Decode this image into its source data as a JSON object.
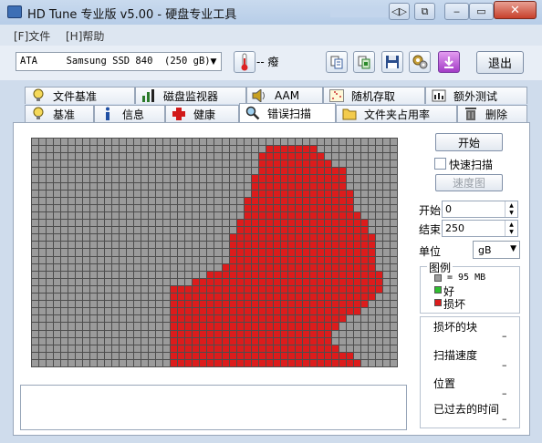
{
  "window": {
    "title": "HD Tune 专业版 v5.00 - 硬盘专业工具",
    "controls": {
      "compact": "◁▷",
      "copy": "⧉",
      "minimize": "‒",
      "maximize": "▭",
      "close": "✕"
    }
  },
  "menu": {
    "file": "[F]文件",
    "help": "[H]帮助"
  },
  "toolbar": {
    "drive": "ATA     Samsung SSD 840  (250 gB)",
    "temperature": "-- 癈",
    "exit": "退出",
    "icons": [
      "thermometer-icon",
      "copy-text-icon",
      "copy-screenshot-icon",
      "save-icon",
      "options-icon",
      "download-icon"
    ]
  },
  "tabs": {
    "row1": [
      {
        "label": "文件基准",
        "icon": "file-benchmark-icon"
      },
      {
        "label": "磁盘监视器",
        "icon": "disk-monitor-icon"
      },
      {
        "label": "AAM",
        "icon": "speaker-icon"
      },
      {
        "label": "随机存取",
        "icon": "random-access-icon"
      },
      {
        "label": "额外测试",
        "icon": "extra-tests-icon"
      }
    ],
    "row2": [
      {
        "label": "基准",
        "icon": "benchmark-icon"
      },
      {
        "label": "信息",
        "icon": "info-icon"
      },
      {
        "label": "健康",
        "icon": "health-cross-icon"
      },
      {
        "label": "错误扫描",
        "icon": "magnifier-icon",
        "active": true
      },
      {
        "label": "文件夹占用率",
        "icon": "folder-icon"
      },
      {
        "label": "删除",
        "icon": "trash-icon"
      }
    ]
  },
  "scan": {
    "start_button": "开始",
    "quick_scan_label": "快速扫描",
    "quick_scan_checked": false,
    "speed_map_button": "速度图",
    "start_label": "开始",
    "start_value": "0",
    "end_label": "结束",
    "end_value": "250",
    "unit_label": "单位",
    "unit_value": "gB",
    "legend_title": "图例",
    "legend_block": "= 95 MB",
    "legend_good": "好",
    "legend_bad": "损坏",
    "colors": {
      "ok": "#9b9b9b",
      "good": "#2fbf2f",
      "bad": "#dc1c1c"
    },
    "stats": [
      {
        "label": "损坏的块",
        "value": "–"
      },
      {
        "label": "扫描速度",
        "value": "–"
      },
      {
        "label": "位置",
        "value": "–"
      },
      {
        "label": "已过去的时间",
        "value": "–"
      }
    ],
    "grid": {
      "cols": 50,
      "rows": 31,
      "bad_row_ranges": [
        [],
        [
          [
            32,
            38
          ]
        ],
        [
          [
            31,
            39
          ]
        ],
        [
          [
            31,
            40
          ]
        ],
        [
          [
            31,
            42
          ]
        ],
        [
          [
            30,
            42
          ]
        ],
        [
          [
            30,
            42
          ]
        ],
        [
          [
            30,
            43
          ]
        ],
        [
          [
            29,
            43
          ]
        ],
        [
          [
            29,
            43
          ]
        ],
        [
          [
            29,
            44
          ]
        ],
        [
          [
            28,
            45
          ]
        ],
        [
          [
            28,
            45
          ]
        ],
        [
          [
            27,
            46
          ]
        ],
        [
          [
            27,
            46
          ]
        ],
        [
          [
            27,
            46
          ]
        ],
        [
          [
            27,
            46
          ]
        ],
        [
          [
            26,
            46
          ]
        ],
        [
          [
            24,
            47
          ]
        ],
        [
          [
            22,
            47
          ]
        ],
        [
          [
            19,
            47
          ]
        ],
        [
          [
            19,
            46
          ]
        ],
        [
          [
            19,
            45
          ]
        ],
        [
          [
            19,
            44
          ]
        ],
        [
          [
            19,
            42
          ]
        ],
        [
          [
            19,
            41
          ]
        ],
        [
          [
            19,
            40
          ]
        ],
        [
          [
            19,
            40
          ]
        ],
        [
          [
            19,
            41
          ]
        ],
        [
          [
            19,
            43
          ]
        ],
        [
          [
            19,
            44
          ]
        ]
      ]
    }
  }
}
